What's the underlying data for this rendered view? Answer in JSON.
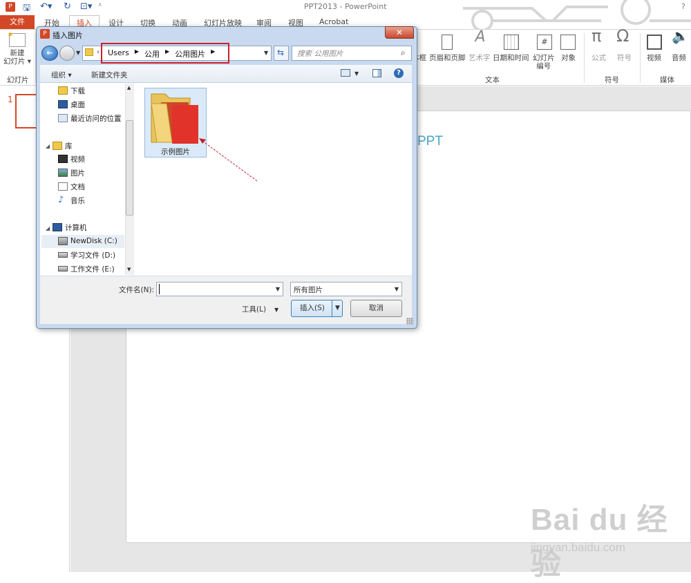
{
  "app": {
    "title": "PPT2013 - PowerPoint",
    "help": "?"
  },
  "tabs": {
    "file": "文件",
    "home": "开始",
    "insert": "插入",
    "design": "设计",
    "transitions": "切换",
    "animations": "动画",
    "slideshow": "幻灯片放映",
    "review": "审阅",
    "view": "视图",
    "acrobat": "Acrobat"
  },
  "ribbon": {
    "new_slide": "新建\n幻灯片",
    "new_slide_l1": "新建",
    "new_slide_l2": "幻灯片 ▾",
    "slides_group": "幻灯片",
    "textbox_partial": "本框",
    "header_footer": "页眉和页脚",
    "wordart": "艺术字",
    "datetime": "日期和时间",
    "slide_number_l1": "幻灯片",
    "slide_number_l2": "编号",
    "object": "对象",
    "text_group": "文本",
    "equation": "公式",
    "symbol": "符号",
    "symbols_group": "符号",
    "video": "视频",
    "audio": "音频",
    "media_group": "媒体"
  },
  "thumbs": {
    "slide_number": "1"
  },
  "slide": {
    "partial_text": "PPT"
  },
  "dialog": {
    "title": "插入图片",
    "close": "✕",
    "breadcrumb": [
      "Users",
      "公用",
      "公用图片"
    ],
    "search_placeholder": "搜索 公用图片",
    "organize": "组织 ▾",
    "new_folder": "新建文件夹",
    "nav_items": [
      {
        "label": "下载",
        "icon": "download-folder-icon"
      },
      {
        "label": "桌面",
        "icon": "desktop-icon"
      },
      {
        "label": "最近访问的位置",
        "icon": "recent-places-icon"
      },
      {
        "label": "库",
        "icon": "library-icon"
      },
      {
        "label": "视频",
        "icon": "videos-icon"
      },
      {
        "label": "图片",
        "icon": "pictures-icon"
      },
      {
        "label": "文档",
        "icon": "documents-icon"
      },
      {
        "label": "音乐",
        "icon": "music-icon"
      },
      {
        "label": "计算机",
        "icon": "computer-icon"
      },
      {
        "label": "NewDisk (C:)",
        "icon": "system-drive-icon"
      },
      {
        "label": "学习文件 (D:)",
        "icon": "drive-icon"
      },
      {
        "label": "工作文件 (E:)",
        "icon": "drive-icon"
      }
    ],
    "folder_label": "示例图片",
    "filename_label": "文件名(N):",
    "filename_value": "",
    "filetype": "所有图片",
    "tools": "工具(L)",
    "insert": "插入(S)",
    "cancel": "取消"
  },
  "watermark": {
    "brand": "Bai  du 经验",
    "sub": "jingyan.baidu.com"
  },
  "colors": {
    "accent": "#d24726",
    "highlight": "#cc1f2b"
  }
}
